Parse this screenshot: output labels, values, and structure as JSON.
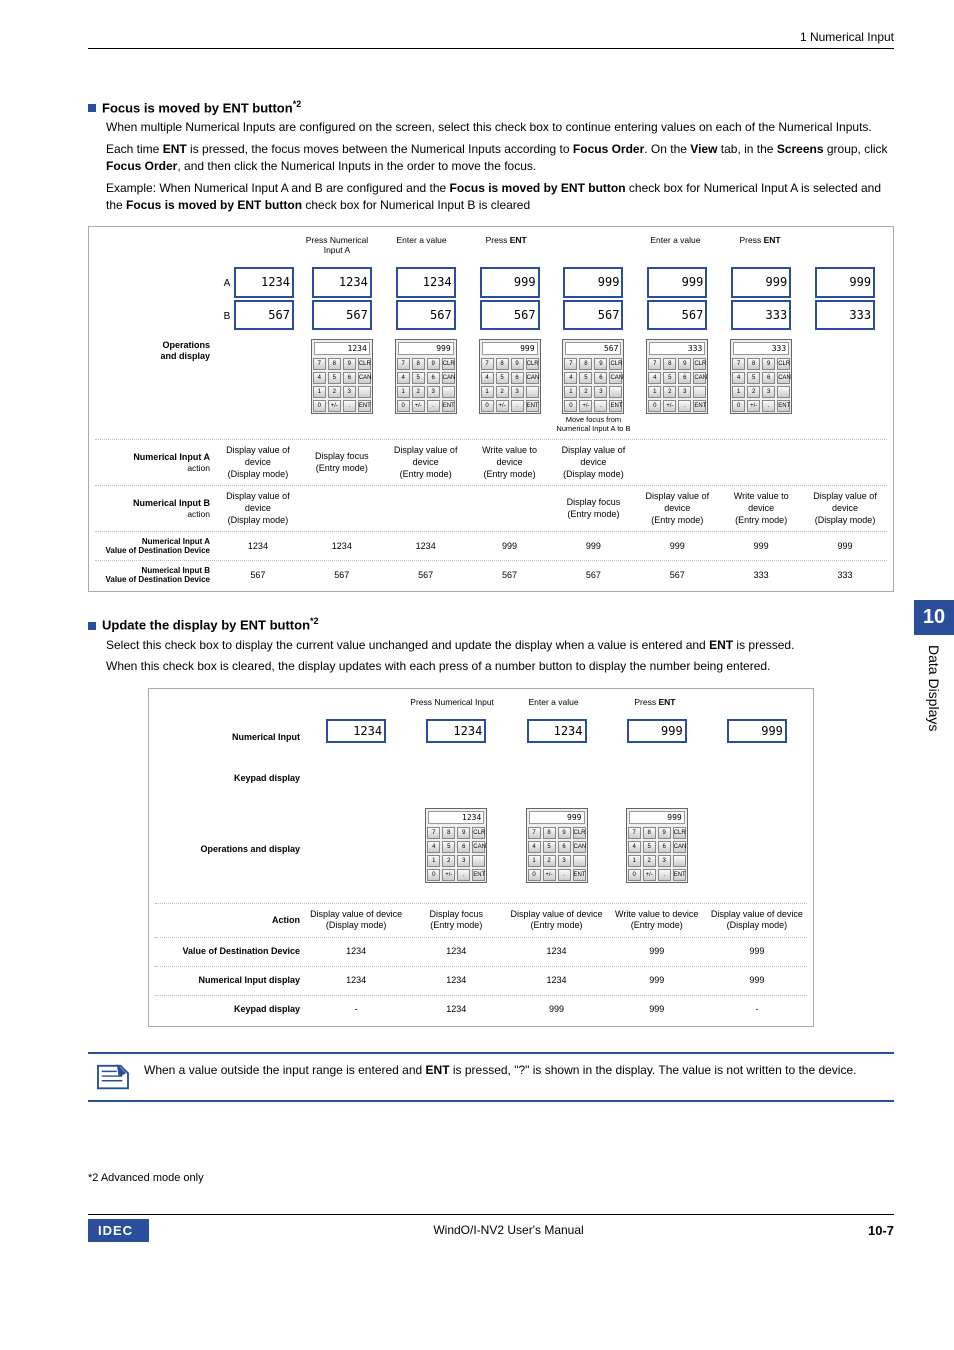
{
  "header": {
    "right": "1 Numerical Input"
  },
  "section1": {
    "title_prefix": "Focus is moved by ENT button",
    "title_sup": "*2",
    "p1": "When multiple Numerical Inputs are configured on the screen, select this check box to continue entering values on each of the Numerical Inputs.",
    "p2_a": "Each time ",
    "p2_b": "ENT",
    "p2_c": " is pressed, the focus moves between the Numerical Inputs according to ",
    "p2_d": "Focus Order",
    "p2_e": ". On the ",
    "p2_f": "View",
    "p2_g": " tab, in the ",
    "p2_h": "Screens",
    "p2_i": " group, click ",
    "p2_j": "Focus Order",
    "p2_k": ", and then click the Numerical Inputs in the order to move the focus.",
    "ex_a": "Example: When Numerical Input A and B are configured and the ",
    "ex_b": "Focus is moved by ENT button",
    "ex_c": " check box for Numerical Input A is selected and the ",
    "ex_d": "Focus is moved by ENT button",
    "ex_e": " check box for Numerical Input B is cleared"
  },
  "diag1": {
    "row_ops_label": "Operations\nand display",
    "labA_main": "Numerical Input A",
    "labA_sub": "action",
    "labB_main": "Numerical Input B",
    "labB_sub": "action",
    "valA_label": "Numerical Input A\nValue of Destination Device",
    "valB_label": "Numerical Input B\nValue of Destination Device",
    "letter_a": "A",
    "letter_b": "B",
    "col_headers": [
      "",
      "Press Numerical Input A",
      "Enter a value",
      "Press ENT",
      "",
      "Enter a value",
      "Press ENT",
      ""
    ],
    "a_vals": [
      "1234",
      "1234",
      "1234",
      "999",
      "999",
      "999",
      "999",
      "999"
    ],
    "b_vals": [
      "567",
      "567",
      "567",
      "567",
      "567",
      "567",
      "333",
      "333"
    ],
    "kp_vals": [
      "",
      "1234",
      "999",
      "999",
      "567",
      "333",
      "333",
      ""
    ],
    "focus_note": "Move focus from\nNumerical Input A to B",
    "rowA_actions": [
      "Display value of device\n(Display mode)",
      "Display focus\n(Entry mode)",
      "Display value of device\n(Entry mode)",
      "Write value to device\n(Entry mode)",
      "Display value of device\n(Display mode)",
      "",
      "",
      ""
    ],
    "rowB_actions": [
      "Display value of device\n(Display mode)",
      "",
      "",
      "",
      "Display focus\n(Entry mode)",
      "Display value of device\n(Entry mode)",
      "Write value to device\n(Entry mode)",
      "Display value of device\n(Display mode)"
    ],
    "rowA_vals": [
      "1234",
      "1234",
      "1234",
      "999",
      "999",
      "999",
      "999",
      "999"
    ],
    "rowB_vals": [
      "567",
      "567",
      "567",
      "567",
      "567",
      "567",
      "333",
      "333"
    ]
  },
  "section2": {
    "title_prefix": "Update the display by ENT button",
    "title_sup": "*2",
    "p1_a": "Select this check box to display the current value unchanged and update the display when a value is entered and ",
    "p1_b": "ENT",
    "p1_c": " is pressed.",
    "p2": "When this check box is cleared, the display updates with each press of a number button to display the number being entered."
  },
  "diag2": {
    "lab_ni": "Numerical Input",
    "lab_kp": "Keypad display",
    "lab_ops": "Operations and display",
    "lab_action": "Action",
    "lab_val": "Value of Destination Device",
    "lab_nid": "Numerical Input display",
    "lab_kpd": "Keypad display",
    "col_headers": [
      "",
      "Press Numerical Input",
      "Enter a value",
      "Press ENT",
      ""
    ],
    "ni_vals": [
      "1234",
      "1234",
      "1234",
      "999",
      "999"
    ],
    "kp_vals": [
      "",
      "1234",
      "999",
      "999",
      ""
    ],
    "actions": [
      "Display value of device\n(Display mode)",
      "Display focus\n(Entry mode)",
      "Display value of device\n(Entry mode)",
      "Write value to device\n(Entry mode)",
      "Display value of device\n(Display mode)"
    ],
    "row_val": [
      "1234",
      "1234",
      "1234",
      "999",
      "999"
    ],
    "row_nid": [
      "1234",
      "1234",
      "1234",
      "999",
      "999"
    ],
    "row_kpd": [
      "-",
      "1234",
      "999",
      "999",
      "-"
    ]
  },
  "note": {
    "t1": "When a value outside the input range is entered and ",
    "t2": "ENT",
    "t3": " is pressed, \"?\" is shown in the display. The value is not written to the device."
  },
  "footnote": "*2  Advanced mode only",
  "sidebar": {
    "num": "10",
    "label": "Data Displays"
  },
  "footer": {
    "logo": "IDEC",
    "center": "WindO/I-NV2 User's Manual",
    "page": "10-7"
  },
  "keypad_keys": [
    "7",
    "8",
    "9",
    "CLR",
    "4",
    "5",
    "6",
    "CAN",
    "1",
    "2",
    "3",
    "",
    "0",
    "+/-",
    ".",
    "ENT"
  ]
}
